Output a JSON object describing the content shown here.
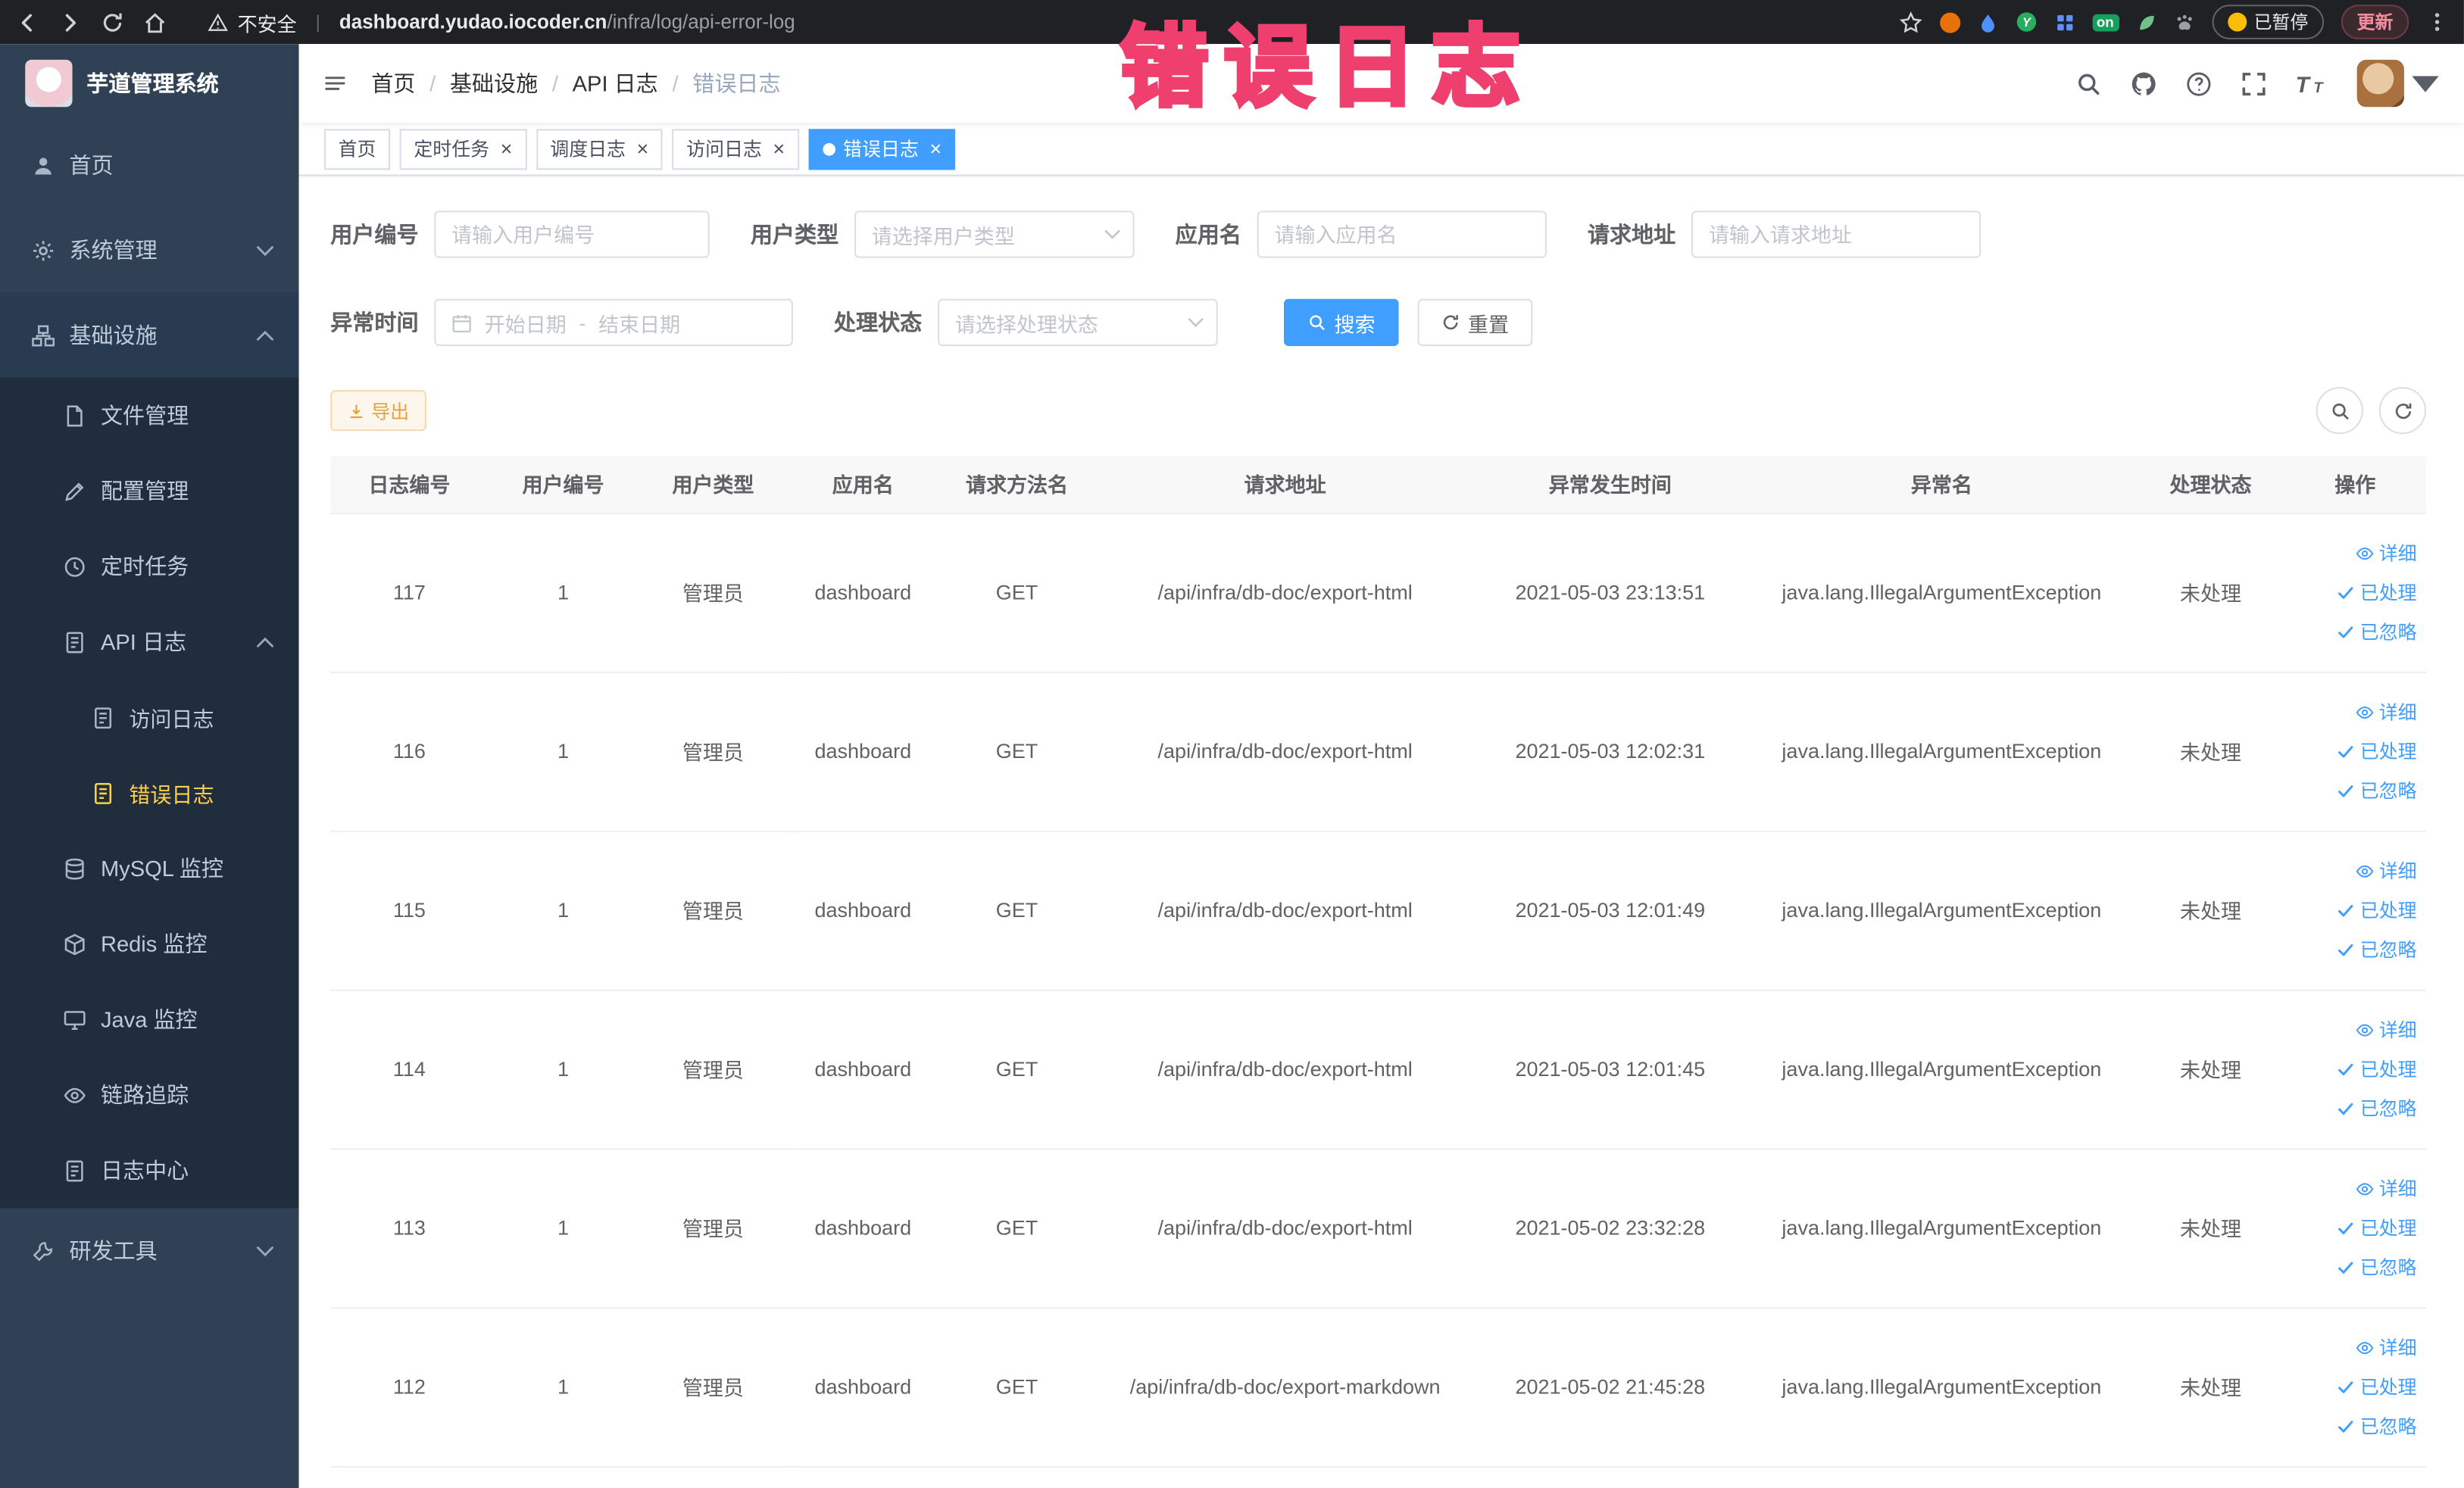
{
  "colors": {
    "accent": "#409eff",
    "warning": "#e6a23c",
    "sidebar_bg": "#304156",
    "active_menu_text": "#ffd04b",
    "annotation_pink": "#ee3f6f"
  },
  "browser": {
    "security_label": "不安全",
    "url_domain": "dashboard.yudao.iocoder.cn",
    "url_path": "/infra/log/api-error-log",
    "extension_badge": "on",
    "paused_label": "已暂停",
    "update_label": "更新"
  },
  "annotation": {
    "text": "错误日志"
  },
  "sidebar": {
    "logo_title": "芋道管理系统",
    "items": [
      {
        "label": "首页"
      },
      {
        "label": "系统管理"
      },
      {
        "label": "基础设施",
        "children": [
          {
            "label": "文件管理"
          },
          {
            "label": "配置管理"
          },
          {
            "label": "定时任务"
          },
          {
            "label": "API 日志",
            "children": [
              {
                "label": "访问日志"
              },
              {
                "label": "错误日志",
                "active": true
              }
            ]
          },
          {
            "label": "MySQL 监控"
          },
          {
            "label": "Redis 监控"
          },
          {
            "label": "Java 监控"
          },
          {
            "label": "链路追踪"
          },
          {
            "label": "日志中心"
          }
        ]
      },
      {
        "label": "研发工具"
      }
    ]
  },
  "navbar": {
    "breadcrumbs": [
      "首页",
      "基础设施",
      "API 日志",
      "错误日志"
    ]
  },
  "tabs": [
    {
      "label": "首页"
    },
    {
      "label": "定时任务"
    },
    {
      "label": "调度日志"
    },
    {
      "label": "访问日志"
    },
    {
      "label": "错误日志"
    }
  ],
  "filters": {
    "user_id_label": "用户编号",
    "user_id_placeholder": "请输入用户编号",
    "user_type_label": "用户类型",
    "user_type_placeholder": "请选择用户类型",
    "app_name_label": "应用名",
    "app_name_placeholder": "请输入应用名",
    "request_url_label": "请求地址",
    "request_url_placeholder": "请输入请求地址",
    "exception_time_label": "异常时间",
    "start_date_placeholder": "开始日期",
    "date_separator": "-",
    "end_date_placeholder": "结束日期",
    "process_status_label": "处理状态",
    "process_status_placeholder": "请选择处理状态",
    "search_label": "搜索",
    "reset_label": "重置"
  },
  "toolbar": {
    "export_label": "导出"
  },
  "table": {
    "columns": [
      "日志编号",
      "用户编号",
      "用户类型",
      "应用名",
      "请求方法名",
      "请求地址",
      "异常发生时间",
      "异常名",
      "处理状态",
      "操作"
    ],
    "actions": [
      "详细",
      "已处理",
      "已忽略"
    ],
    "rows": [
      {
        "id": "117",
        "user_id": "1",
        "user_type": "管理员",
        "app": "dashboard",
        "method": "GET",
        "url": "/api/infra/db-doc/export-html",
        "time": "2021-05-03 23:13:51",
        "exception": "java.lang.IllegalArgumentException",
        "status": "未处理"
      },
      {
        "id": "116",
        "user_id": "1",
        "user_type": "管理员",
        "app": "dashboard",
        "method": "GET",
        "url": "/api/infra/db-doc/export-html",
        "time": "2021-05-03 12:02:31",
        "exception": "java.lang.IllegalArgumentException",
        "status": "未处理"
      },
      {
        "id": "115",
        "user_id": "1",
        "user_type": "管理员",
        "app": "dashboard",
        "method": "GET",
        "url": "/api/infra/db-doc/export-html",
        "time": "2021-05-03 12:01:49",
        "exception": "java.lang.IllegalArgumentException",
        "status": "未处理"
      },
      {
        "id": "114",
        "user_id": "1",
        "user_type": "管理员",
        "app": "dashboard",
        "method": "GET",
        "url": "/api/infra/db-doc/export-html",
        "time": "2021-05-03 12:01:45",
        "exception": "java.lang.IllegalArgumentException",
        "status": "未处理"
      },
      {
        "id": "113",
        "user_id": "1",
        "user_type": "管理员",
        "app": "dashboard",
        "method": "GET",
        "url": "/api/infra/db-doc/export-html",
        "time": "2021-05-02 23:32:28",
        "exception": "java.lang.IllegalArgumentException",
        "status": "未处理"
      },
      {
        "id": "112",
        "user_id": "1",
        "user_type": "管理员",
        "app": "dashboard",
        "method": "GET",
        "url": "/api/infra/db-doc/export-markdown",
        "time": "2021-05-02 21:45:28",
        "exception": "java.lang.IllegalArgumentException",
        "status": "未处理"
      }
    ]
  },
  "icons": {
    "close": "×",
    "breadcrumb_separator": "/",
    "check": "✓"
  }
}
